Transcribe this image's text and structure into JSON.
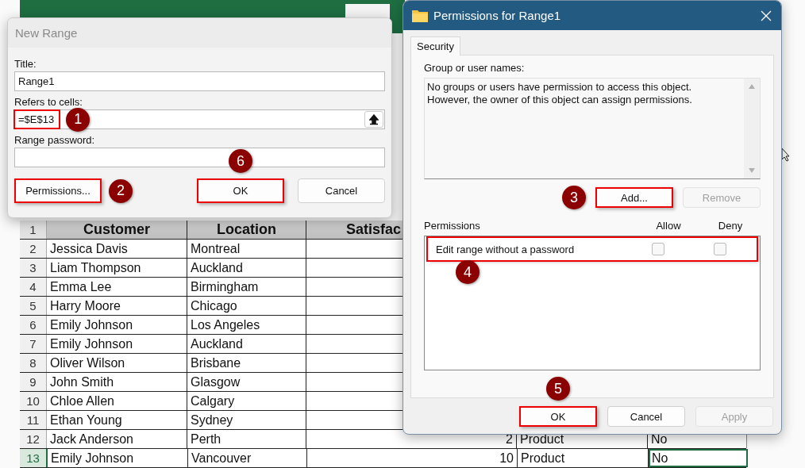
{
  "sheet": {
    "header_row": {
      "num": "1",
      "cells": [
        "Customer",
        "Location",
        "Satisfac"
      ]
    },
    "rows": [
      {
        "num": "2",
        "customer": "Jessica Davis",
        "location": "Montreal",
        "selected": false
      },
      {
        "num": "3",
        "customer": "Liam Thompson",
        "location": "Auckland",
        "selected": false
      },
      {
        "num": "4",
        "customer": "Emma Lee",
        "location": "Birmingham",
        "selected": false
      },
      {
        "num": "5",
        "customer": "Harry Moore",
        "location": "Chicago",
        "selected": false
      },
      {
        "num": "6",
        "customer": "Emily Johnson",
        "location": "Los Angeles",
        "selected": false
      },
      {
        "num": "7",
        "customer": "Emily Johnson",
        "location": "Auckland",
        "selected": false
      },
      {
        "num": "8",
        "customer": "Oliver Wilson",
        "location": "Brisbane",
        "selected": false
      },
      {
        "num": "9",
        "customer": "John Smith",
        "location": "Glasgow",
        "selected": false
      },
      {
        "num": "10",
        "customer": "Chloe Allen",
        "location": "Calgary",
        "selected": false
      },
      {
        "num": "11",
        "customer": "Ethan Young",
        "location": "Sydney",
        "selected": false
      },
      {
        "num": "12",
        "customer": "Jack Anderson",
        "location": "Perth",
        "satisfaction": "2",
        "product": "Product",
        "column_5": "No",
        "selected": false
      },
      {
        "num": "13",
        "customer": "Emily Johnson",
        "location": "Vancouver",
        "satisfaction": "10",
        "product": "Product",
        "column_5": "No",
        "selected": true
      }
    ]
  },
  "new_range": {
    "title": "New Range",
    "fields": [
      {
        "label": "Title:",
        "value": "Range1"
      },
      {
        "label": "Refers to cells:",
        "value": "=$E$13",
        "highlighted": true,
        "callout": "1"
      },
      {
        "label": "Range password:"
      }
    ],
    "buttons": [
      {
        "label": "Permissions...",
        "highlighted": true,
        "callout": "2"
      },
      {
        "label": "OK",
        "highlighted": true,
        "callout": "6"
      },
      {
        "label": "Cancel",
        "highlighted": false
      }
    ]
  },
  "permissions": {
    "title": "Permissions for Range1",
    "tabs": [
      {
        "label": "Security",
        "selected": true
      }
    ],
    "group_label": "Group or user names:",
    "group_message_lines": [
      "No groups or users have permission to access this object.",
      "However, the owner of this object can assign permissions."
    ],
    "group_buttons": [
      {
        "label": "Add...",
        "disabled": false,
        "highlighted": true,
        "callout": "3"
      },
      {
        "label": "Remove",
        "disabled": true,
        "highlighted": false
      }
    ],
    "perm_header": {
      "name": "Permissions",
      "allow": "Allow",
      "deny": "Deny"
    },
    "perm_rows": [
      {
        "name": "Edit range without a password",
        "allow": false,
        "deny": false,
        "highlighted": true,
        "callout": "4"
      }
    ],
    "buttons": [
      {
        "label": "OK",
        "disabled": false,
        "highlighted": true,
        "callout": "5"
      },
      {
        "label": "Cancel",
        "disabled": false,
        "highlighted": false
      },
      {
        "label": "Apply",
        "disabled": true,
        "highlighted": false
      }
    ]
  }
}
